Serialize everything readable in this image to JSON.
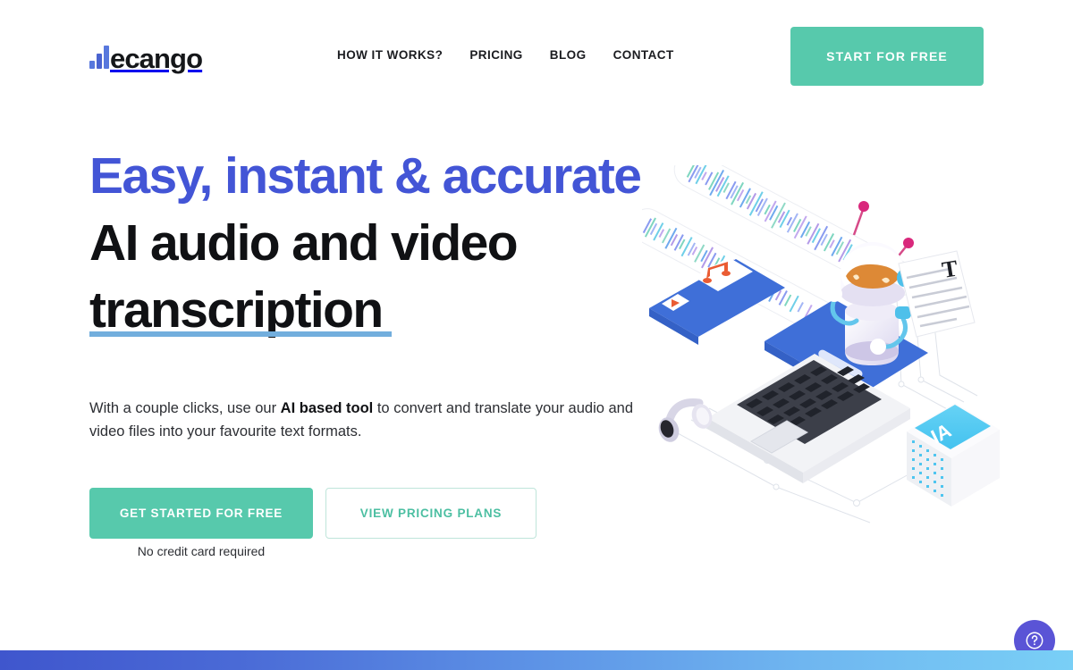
{
  "brand": {
    "name": "ecango",
    "logo_icon": "bar-chart-logo-icon",
    "accent_blue": "#4355d6",
    "accent_green": "#57c9ac",
    "underline_blue": "#72aedd"
  },
  "nav": {
    "items": [
      {
        "label": "HOW IT WORKS?"
      },
      {
        "label": "PRICING"
      },
      {
        "label": "BLOG"
      },
      {
        "label": "CONTACT"
      }
    ],
    "cta_label": "START FOR FREE"
  },
  "hero": {
    "headline_line1": "Easy, instant & accurate",
    "headline_line2": "AI audio and video",
    "headline_line3": "transcription",
    "subtitle_part1": "With a couple clicks, use our ",
    "subtitle_bold": "AI based tool",
    "subtitle_part2": " to convert and translate your audio and video files into your favourite text formats.",
    "primary_button": "GET STARTED FOR FREE",
    "secondary_button": "VIEW PRICING PLANS",
    "note": "No credit card required"
  },
  "illustration": {
    "name": "ai-transcription-isometric-illustration",
    "elements": [
      "audio-waveform-card",
      "audio-waveform-card",
      "tablet-music-player",
      "laptop",
      "robot-assistant",
      "text-document",
      "ia-cube",
      "headphones"
    ],
    "document_glyph": "T",
    "cube_label": "IA"
  },
  "help": {
    "icon": "question-mark-circle-icon",
    "color": "#5a54d6"
  },
  "footer": {
    "gradient_from": "#3f56cd",
    "gradient_to": "#79cff6"
  }
}
